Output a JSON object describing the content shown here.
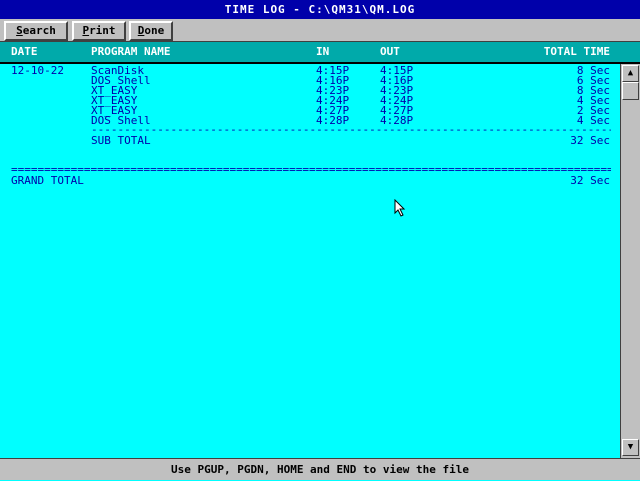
{
  "window": {
    "title": "TIME LOG - C:\\QM31\\QM.LOG"
  },
  "toolbar": {
    "search": {
      "hotkey": "S",
      "rest": "earch"
    },
    "print": {
      "hotkey": "P",
      "rest": "rint"
    },
    "done": {
      "hotkey": "D",
      "rest": "one"
    }
  },
  "columns": {
    "date": "DATE",
    "program": "PROGRAM NAME",
    "in": "IN",
    "out": "OUT",
    "total": "TOTAL TIME"
  },
  "log": {
    "date": "12-10-22",
    "entries": [
      {
        "program": "ScanDisk",
        "in": "4:15P",
        "out": "4:15P",
        "total": "8 Sec"
      },
      {
        "program": "DOS Shell",
        "in": "4:16P",
        "out": "4:16P",
        "total": "6 Sec"
      },
      {
        "program": "XT_EASY",
        "in": "4:23P",
        "out": "4:23P",
        "total": "8 Sec"
      },
      {
        "program": "XT_EASY",
        "in": "4:24P",
        "out": "4:24P",
        "total": "4 Sec"
      },
      {
        "program": "XT_EASY",
        "in": "4:27P",
        "out": "4:27P",
        "total": "2 Sec"
      },
      {
        "program": "DOS Shell",
        "in": "4:28P",
        "out": "4:28P",
        "total": "4 Sec"
      }
    ],
    "subtotal_label": "SUB TOTAL",
    "subtotal_value": "32 Sec",
    "grand_total_label": "GRAND TOTAL",
    "grand_total_value": "32 Sec"
  },
  "scrollbar": {
    "up_icon": "triangle-up",
    "down_icon": "triangle-down"
  },
  "status": {
    "text": "Use PGUP, PGDN, HOME and END to view the file"
  }
}
